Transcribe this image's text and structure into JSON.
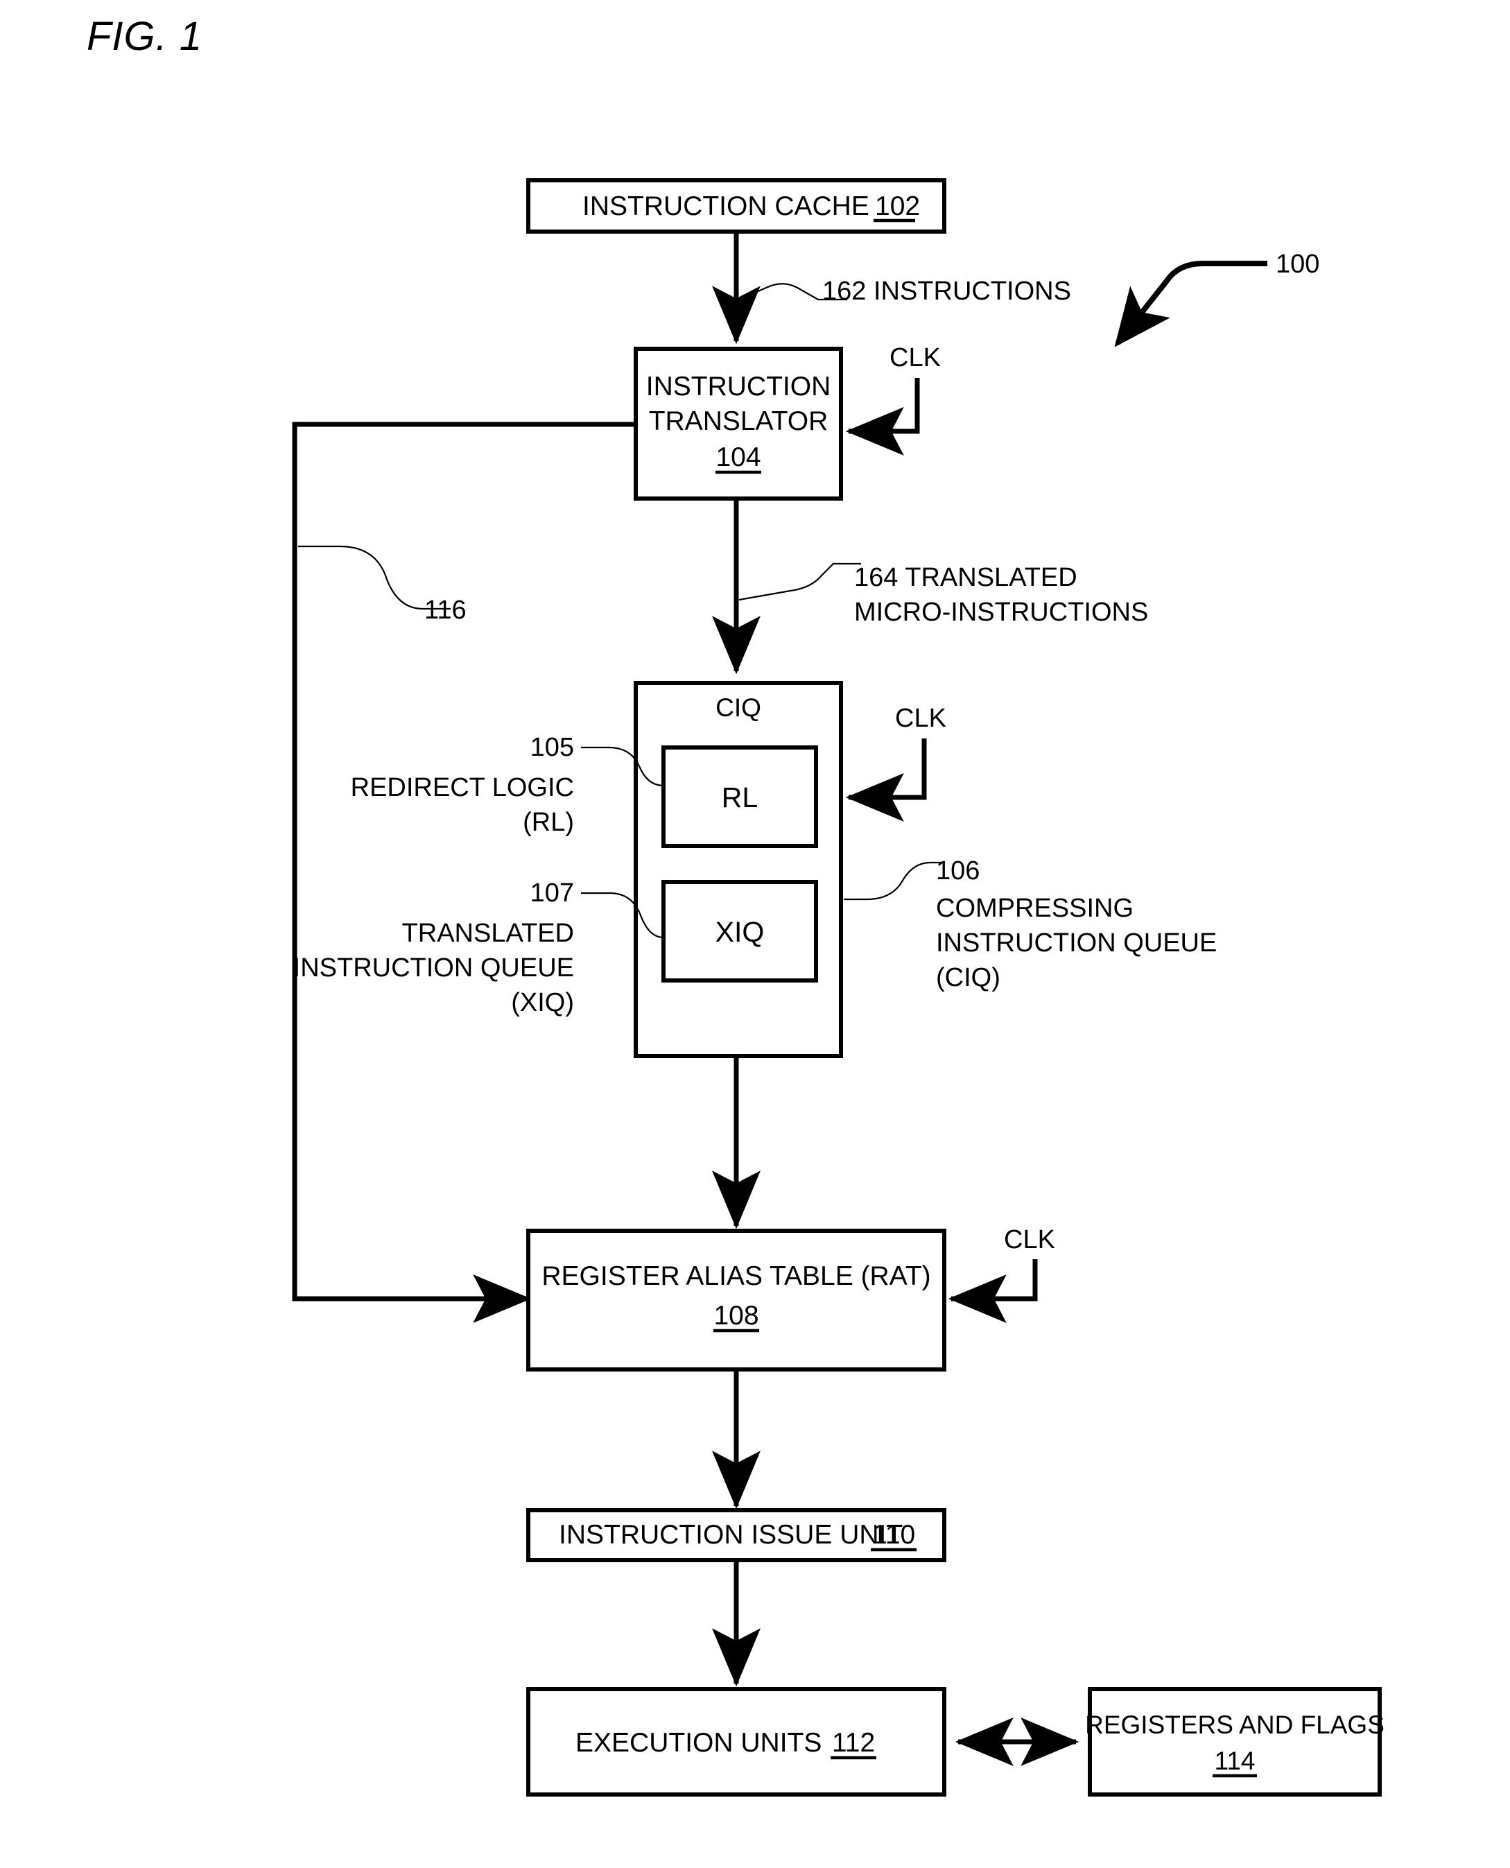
{
  "figure": {
    "title": "FIG. 1",
    "overall_reference": "100"
  },
  "blocks": {
    "instruction_cache": {
      "label": "INSTRUCTION CACHE",
      "ref": "102"
    },
    "instruction_translator": {
      "line1": "INSTRUCTION",
      "line2": "TRANSLATOR",
      "ref": "104"
    },
    "ciq": {
      "top_label": "CIQ"
    },
    "rl": {
      "label": "RL"
    },
    "xiq": {
      "label": "XIQ"
    },
    "rat": {
      "label": "REGISTER ALIAS TABLE (RAT)",
      "ref": "108"
    },
    "instruction_issue_unit": {
      "label": "INSTRUCTION ISSUE UNIT",
      "ref": "110"
    },
    "execution_units": {
      "label": "EXECUTION UNITS",
      "ref": "112"
    },
    "registers_and_flags": {
      "label": "REGISTERS AND FLAGS",
      "ref": "114"
    }
  },
  "signals": {
    "clk_translator": "CLK",
    "clk_ciq": "CLK",
    "clk_rat": "CLK",
    "instructions_162": "162 INSTRUCTIONS",
    "translated_164_line1": "164 TRANSLATED",
    "translated_164_line2": "MICRO-INSTRUCTIONS",
    "feedback_116": "116"
  },
  "annotations": {
    "rl_ref": "105",
    "rl_line1": "REDIRECT LOGIC",
    "rl_line2": "(RL)",
    "xiq_ref": "107",
    "xiq_line1": "TRANSLATED",
    "xiq_line2": "INSTRUCTION QUEUE",
    "xiq_line3": "(XIQ)",
    "ciq_ref": "106",
    "ciq_line1": "COMPRESSING",
    "ciq_line2": "INSTRUCTION QUEUE",
    "ciq_line3": "(CIQ)"
  },
  "colors": {
    "ink": "#000000",
    "paper": "#ffffff"
  }
}
